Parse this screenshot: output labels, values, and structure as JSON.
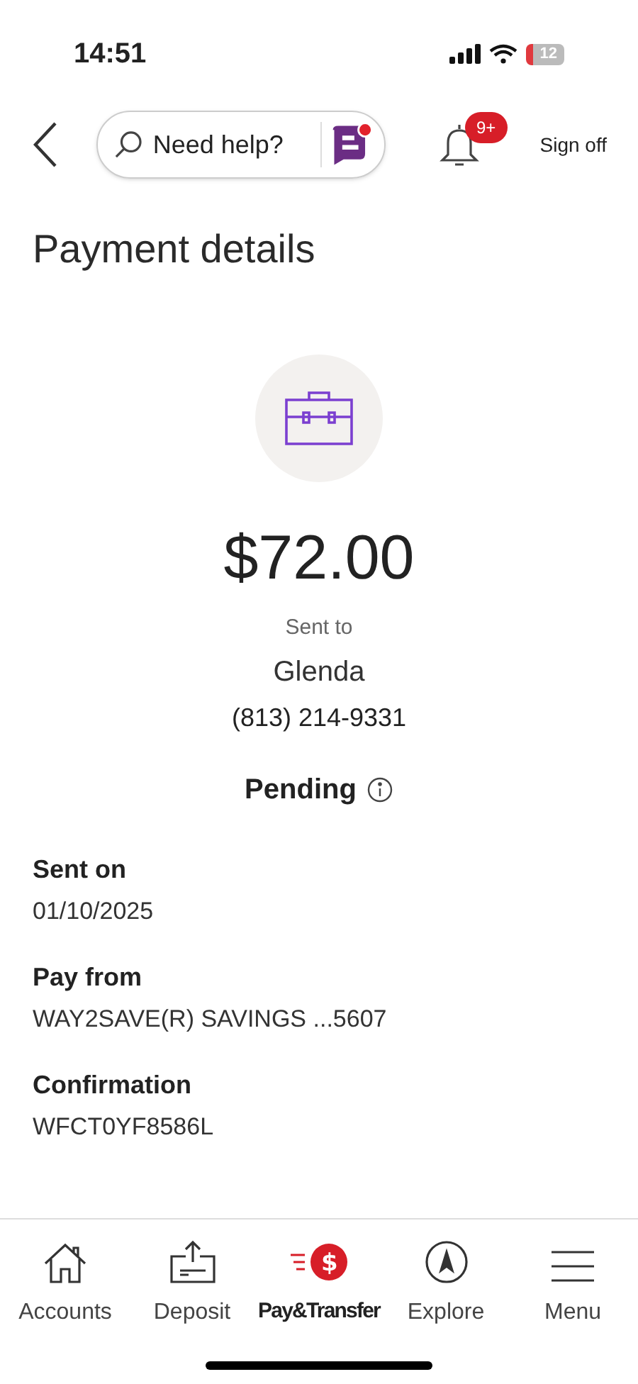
{
  "status_bar": {
    "time": "14:51",
    "battery": "12"
  },
  "header": {
    "search": {
      "placeholder": "Need help?"
    },
    "notifications_badge": "9+",
    "sign_off": "Sign off"
  },
  "title": "Payment details",
  "payment": {
    "amount": "$72.00",
    "sent_to_label": "Sent to",
    "recipient": "Glenda",
    "phone": "(813) 214-9331",
    "status": "Pending"
  },
  "details": [
    {
      "label": "Sent on",
      "value": "01/10/2025"
    },
    {
      "label": "Pay from",
      "value": "WAY2SAVE(R) SAVINGS ...5607"
    },
    {
      "label": "Confirmation",
      "value": "WFCT0YF8586L"
    }
  ],
  "tabs": [
    {
      "kind": "home",
      "label": "Accounts",
      "selected": false
    },
    {
      "kind": "deposit",
      "label": "Deposit",
      "selected": false
    },
    {
      "kind": "pay",
      "label": "Pay&Transfer",
      "icon_text": "$",
      "selected": true
    },
    {
      "kind": "explore",
      "label": "Explore",
      "selected": false
    },
    {
      "kind": "menu",
      "label": "Menu",
      "selected": false
    }
  ]
}
